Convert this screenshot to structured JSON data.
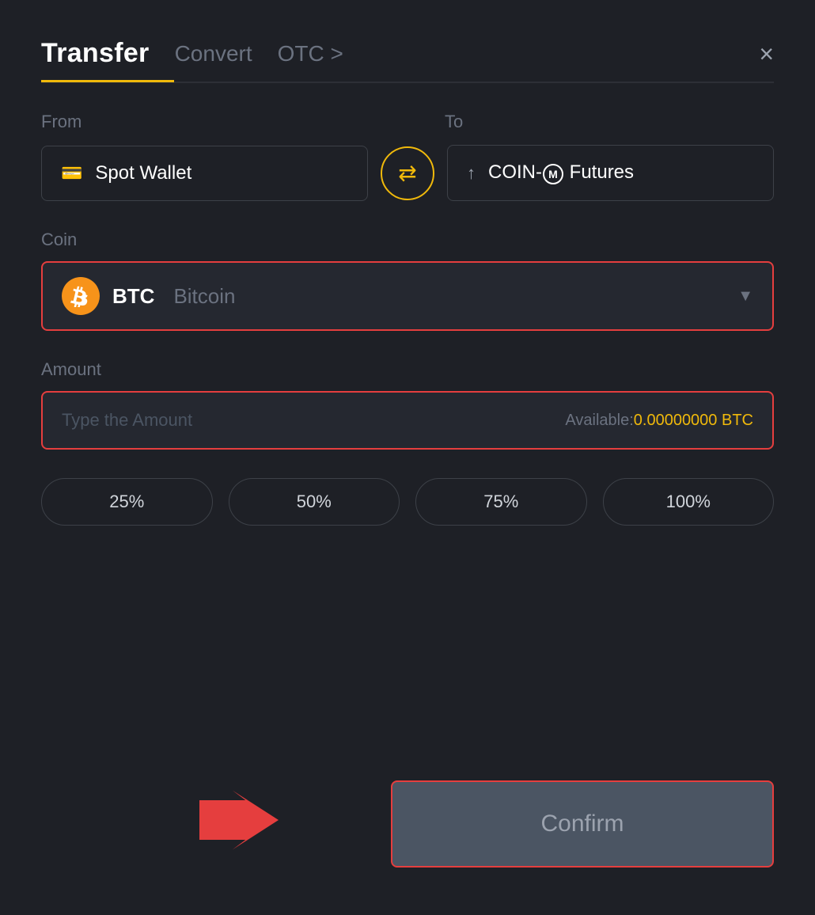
{
  "header": {
    "title": "Transfer",
    "tab_convert": "Convert",
    "tab_otc": "OTC >",
    "close_label": "×"
  },
  "from": {
    "label": "From",
    "wallet_text": "Spot Wallet",
    "wallet_icon": "💳"
  },
  "to": {
    "label": "To",
    "wallet_text": "COIN-Ⓜ Futures",
    "wallet_icon": "↑"
  },
  "coin": {
    "label": "Coin",
    "symbol": "BTC",
    "name": "Bitcoin",
    "btc_letter": "₿"
  },
  "amount": {
    "label": "Amount",
    "placeholder": "Type the Amount",
    "available_label": "Available: ",
    "available_value": "0.00000000 BTC"
  },
  "percent_buttons": [
    {
      "label": "25%"
    },
    {
      "label": "50%"
    },
    {
      "label": "75%"
    },
    {
      "label": "100%"
    }
  ],
  "confirm_button": {
    "label": "Confirm"
  }
}
